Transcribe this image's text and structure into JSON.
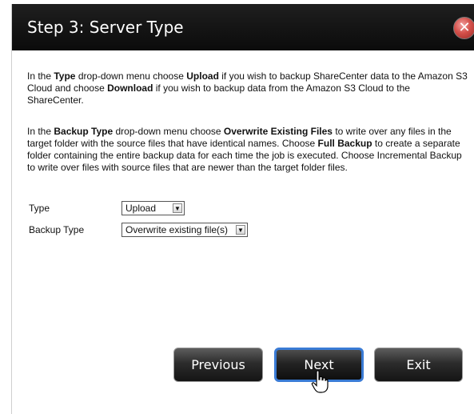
{
  "dialog": {
    "title": "Step 3: Server Type",
    "close_icon": "close-icon"
  },
  "instructions": {
    "p1": [
      {
        "t": "In the ",
        "b": false
      },
      {
        "t": "Type",
        "b": true
      },
      {
        "t": " drop-down menu choose ",
        "b": false
      },
      {
        "t": "Upload",
        "b": true
      },
      {
        "t": " if you wish to backup ShareCenter data to the Amazon S3 Cloud and choose ",
        "b": false
      },
      {
        "t": "Download",
        "b": true
      },
      {
        "t": " if you wish to backup data from the Amazon S3 Cloud to the ShareCenter.",
        "b": false
      }
    ],
    "p2": [
      {
        "t": "In the ",
        "b": false
      },
      {
        "t": "Backup Type",
        "b": true
      },
      {
        "t": " drop-down menu choose ",
        "b": false
      },
      {
        "t": "Overwrite Existing Files",
        "b": true
      },
      {
        "t": " to write over any files in the target folder with the source files that have identical names. Choose ",
        "b": false
      },
      {
        "t": "Full Backup",
        "b": true
      },
      {
        "t": " to create a separate folder containing the entire backup data for each time the job is executed. Choose Incremental Backup to write over files with source files that are newer than the target folder files.",
        "b": false
      }
    ]
  },
  "form": {
    "type_label": "Type",
    "type_value": "Upload",
    "backup_type_label": "Backup Type",
    "backup_type_value": "Overwrite existing file(s)"
  },
  "buttons": {
    "previous": "Previous",
    "next": "Next",
    "exit": "Exit"
  }
}
